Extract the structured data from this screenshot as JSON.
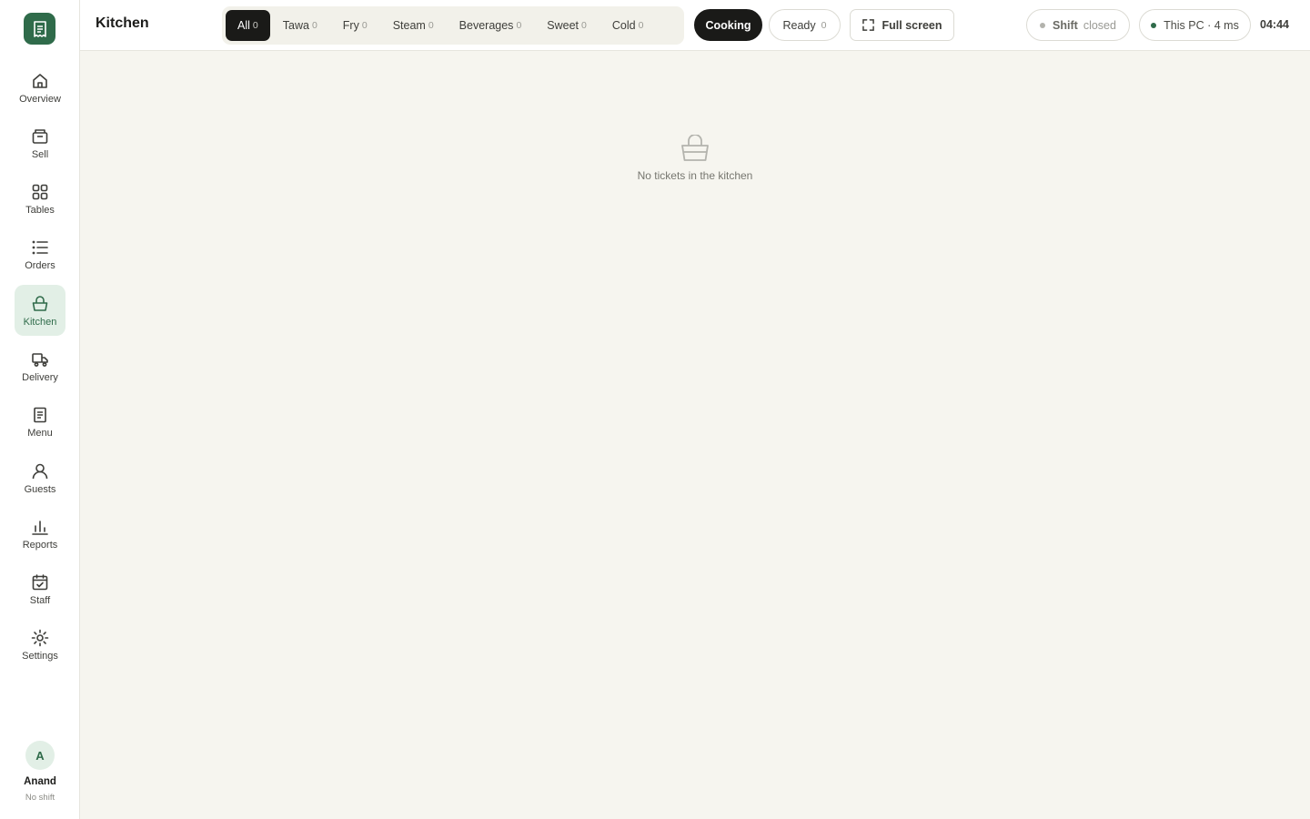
{
  "sidebar": {
    "items": [
      {
        "label": "Overview"
      },
      {
        "label": "Sell"
      },
      {
        "label": "Tables"
      },
      {
        "label": "Orders"
      },
      {
        "label": "Kitchen"
      },
      {
        "label": "Delivery"
      },
      {
        "label": "Menu"
      },
      {
        "label": "Guests"
      },
      {
        "label": "Reports"
      },
      {
        "label": "Staff"
      },
      {
        "label": "Settings"
      }
    ],
    "user": {
      "initial": "A",
      "name": "Anand",
      "status": "No shift"
    }
  },
  "header": {
    "title": "Kitchen",
    "stations": [
      {
        "label": "All",
        "count": "0"
      },
      {
        "label": "Tawa",
        "count": "0"
      },
      {
        "label": "Fry",
        "count": "0"
      },
      {
        "label": "Steam",
        "count": "0"
      },
      {
        "label": "Beverages",
        "count": "0"
      },
      {
        "label": "Sweet",
        "count": "0"
      },
      {
        "label": "Cold",
        "count": "0"
      }
    ],
    "cooking_label": "Cooking",
    "ready_label": "Ready",
    "ready_count": "0",
    "fullscreen_label": "Full screen",
    "shift_label": "Shift",
    "shift_status": "closed",
    "device_label": "This PC · 4 ms",
    "clock": "04:44"
  },
  "main": {
    "empty_message": "No tickets in the kitchen"
  },
  "colors": {
    "accent": "#2f6b4a",
    "accent_soft": "#e2efe6",
    "dark": "#1a1a18",
    "background": "#f6f5ef",
    "online_dot": "#2f6b4a",
    "shift_dot": "#b3b3ad"
  }
}
